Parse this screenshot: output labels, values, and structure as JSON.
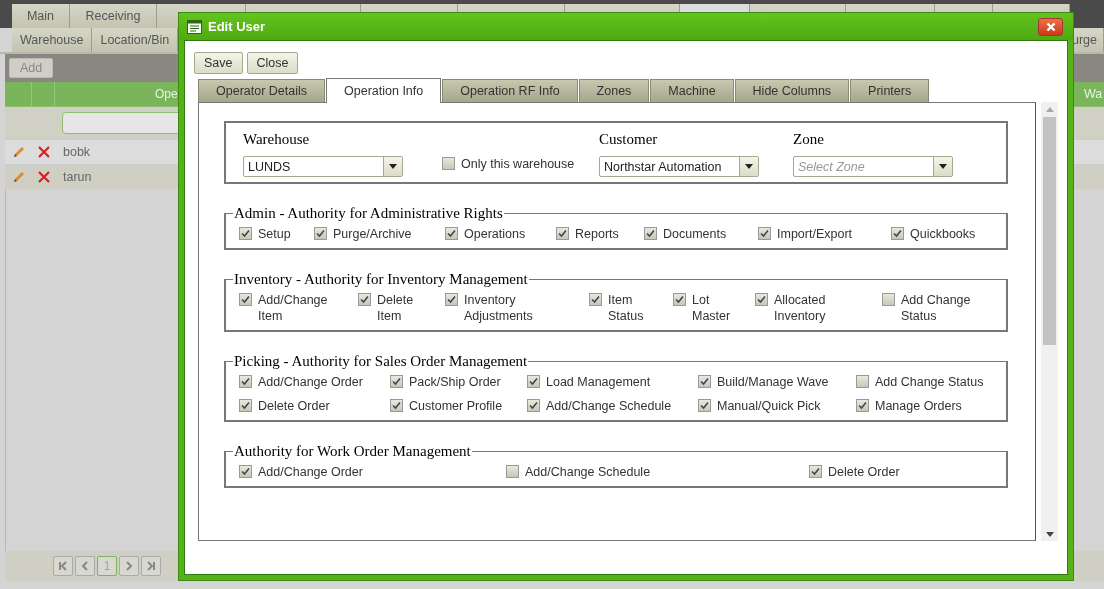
{
  "main_tabs": [
    {
      "label": "Main",
      "selected": false
    },
    {
      "label": "Receiving",
      "selected": false
    },
    {
      "selected": false
    },
    {
      "selected": false
    },
    {
      "selected": false
    },
    {
      "selected": false
    },
    {
      "selected": false
    },
    {
      "selected": true
    },
    {
      "selected": false
    },
    {
      "selected": false
    },
    {
      "selected": false
    },
    {
      "selected": false
    }
  ],
  "sub_tabs": [
    {
      "label": "Warehouse"
    },
    {
      "label": "Location/Bin"
    },
    {
      "label": "urge"
    }
  ],
  "toolbar": {
    "add_button": "Add"
  },
  "grid": {
    "columns": [
      "Ope",
      "Wa"
    ],
    "rows": [
      {
        "user": "bobk"
      },
      {
        "user": "tarun"
      }
    ]
  },
  "pager": {
    "page": "1"
  },
  "window": {
    "title": "Edit User"
  },
  "buttons": [
    "Save",
    "Close"
  ],
  "tabs": [
    {
      "label": "Operator Details",
      "selected": false
    },
    {
      "label": "Operation Info",
      "selected": true
    },
    {
      "label": "Operation RF Info",
      "selected": false
    },
    {
      "label": "Zones",
      "selected": false
    },
    {
      "label": "Machine",
      "selected": false
    },
    {
      "label": "Hide Columns",
      "selected": false
    },
    {
      "label": "Printers",
      "selected": false
    }
  ],
  "filters": {
    "warehouse": {
      "label": "Warehouse",
      "value": "LUNDS"
    },
    "only_this_warehouse": {
      "label": "Only this warehouse",
      "checked": false
    },
    "customer": {
      "label": "Customer",
      "value": "Northstar Automation"
    },
    "zone": {
      "label": "Zone",
      "placeholder": "Select Zone"
    }
  },
  "sections": [
    {
      "title": "Admin - Authority for Administrative Rights",
      "items": [
        {
          "label": "Setup",
          "checked": true
        },
        {
          "label": "Purge/Archive",
          "checked": true
        },
        {
          "label": "Operations",
          "checked": true
        },
        {
          "label": "Reports",
          "checked": true
        },
        {
          "label": "Documents",
          "checked": true
        },
        {
          "label": "Import/Export",
          "checked": true
        },
        {
          "label": "Quickbooks",
          "checked": true
        }
      ]
    },
    {
      "title": "Inventory - Authority for Inventory Management",
      "items": [
        {
          "label": "Add/Change Item",
          "checked": true
        },
        {
          "label": "Delete Item",
          "checked": true
        },
        {
          "label": "Inventory Adjustments",
          "checked": true
        },
        {
          "label": "Item Status",
          "checked": true
        },
        {
          "label": "Lot Master",
          "checked": true
        },
        {
          "label": "Allocated Inventory",
          "checked": true
        },
        {
          "label": "Add Change Status",
          "checked": false
        }
      ]
    },
    {
      "title": "Picking - Authority for Sales Order Management",
      "items": [
        {
          "label": "Add/Change Order",
          "checked": true
        },
        {
          "label": "Pack/Ship Order",
          "checked": true
        },
        {
          "label": "Load Management",
          "checked": true
        },
        {
          "label": "Build/Manage Wave",
          "checked": true
        },
        {
          "label": "Add Change Status",
          "checked": false
        },
        {
          "label": "Delete Order",
          "checked": true
        },
        {
          "label": "Customer Profile",
          "checked": true
        },
        {
          "label": "Add/Change Schedule",
          "checked": true
        },
        {
          "label": "Manual/Quick Pick",
          "checked": true
        },
        {
          "label": "Manage Orders",
          "checked": true
        }
      ]
    },
    {
      "title": "Authority for Work Order Management",
      "items": [
        {
          "label": "Add/Change Order",
          "checked": true
        },
        {
          "label": "Add/Change Schedule",
          "checked": false
        },
        {
          "label": "Delete Order",
          "checked": true
        }
      ]
    }
  ]
}
